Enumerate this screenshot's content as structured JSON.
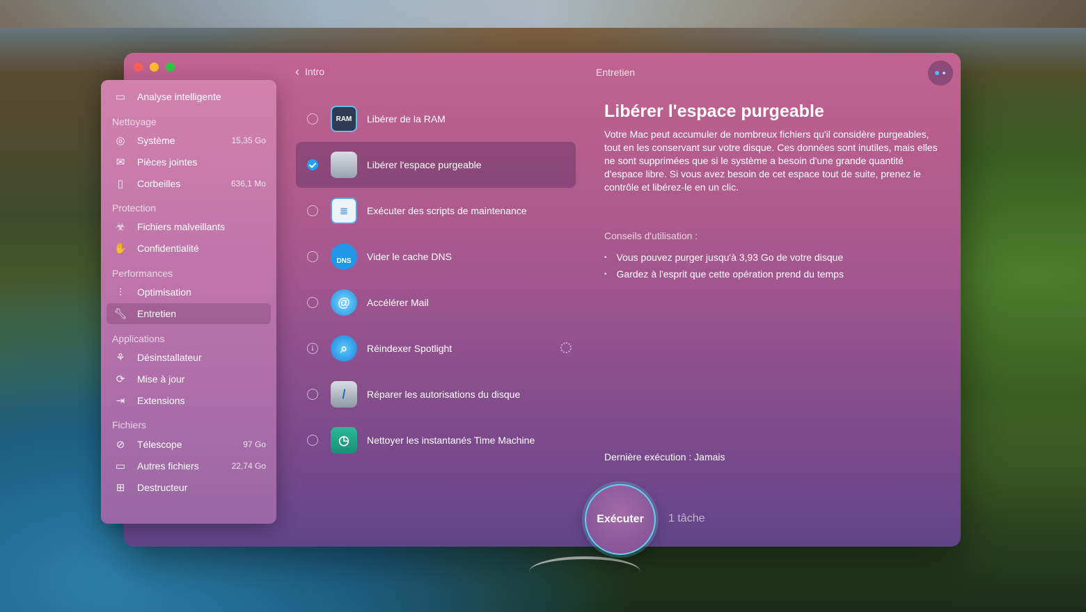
{
  "window": {
    "breadcrumb_back": "Intro",
    "title": "Entretien"
  },
  "sidebar": {
    "top_item": {
      "label": "Analyse intelligente",
      "icon": "monitor-icon"
    },
    "sections": [
      {
        "title": "Nettoyage",
        "items": [
          {
            "label": "Système",
            "size": "15,35 Go",
            "icon": "disk-icon"
          },
          {
            "label": "Pièces jointes",
            "size": "",
            "icon": "mail-icon"
          },
          {
            "label": "Corbeilles",
            "size": "636,1 Mo",
            "icon": "trash-icon"
          }
        ]
      },
      {
        "title": "Protection",
        "items": [
          {
            "label": "Fichiers malveillants",
            "size": "",
            "icon": "biohazard-icon"
          },
          {
            "label": "Confidentialité",
            "size": "",
            "icon": "hand-icon"
          }
        ]
      },
      {
        "title": "Performances",
        "items": [
          {
            "label": "Optimisation",
            "size": "",
            "icon": "sliders-icon"
          },
          {
            "label": "Entretien",
            "size": "",
            "icon": "wrench-icon",
            "active": true
          }
        ]
      },
      {
        "title": "Applications",
        "items": [
          {
            "label": "Désinstallateur",
            "size": "",
            "icon": "apps-icon"
          },
          {
            "label": "Mise à jour",
            "size": "",
            "icon": "update-icon"
          },
          {
            "label": "Extensions",
            "size": "",
            "icon": "extensions-icon"
          }
        ]
      },
      {
        "title": "Fichiers",
        "items": [
          {
            "label": "Télescope",
            "size": "97 Go",
            "icon": "telescope-icon"
          },
          {
            "label": "Autres fichiers",
            "size": "22,74 Go",
            "icon": "folder-icon"
          },
          {
            "label": "Destructeur",
            "size": "",
            "icon": "shredder-icon"
          }
        ]
      }
    ]
  },
  "tasks": [
    {
      "label": "Libérer de la RAM",
      "state": "unchecked",
      "icon": "ram-icon",
      "icon_text": "RAM"
    },
    {
      "label": "Libérer l'espace purgeable",
      "state": "checked",
      "icon": "drive-icon",
      "icon_text": ""
    },
    {
      "label": "Exécuter des scripts de maintenance",
      "state": "unchecked",
      "icon": "clipboard-icon",
      "icon_text": ""
    },
    {
      "label": "Vider le cache DNS",
      "state": "unchecked",
      "icon": "dns-icon",
      "icon_text": "DNS"
    },
    {
      "label": "Accélérer Mail",
      "state": "unchecked",
      "icon": "mail-speed-icon",
      "icon_text": ""
    },
    {
      "label": "Réindexer Spotlight",
      "state": "info",
      "icon": "spotlight-icon",
      "icon_text": ""
    },
    {
      "label": "Réparer les autorisations du disque",
      "state": "unchecked",
      "icon": "disk-repair-icon",
      "icon_text": ""
    },
    {
      "label": "Nettoyer les instantanés Time Machine",
      "state": "unchecked",
      "icon": "time-machine-icon",
      "icon_text": ""
    }
  ],
  "detail": {
    "title": "Libérer l'espace purgeable",
    "description": "Votre Mac peut accumuler de nombreux fichiers qu'il considère purgeables, tout en les conservant sur votre disque. Ces données sont inutiles, mais elles ne sont supprimées que si le système a besoin d'une grande quantité d'espace libre. Si vous avez besoin de cet espace tout de suite, prenez le contrôle et libérez-le en un clic.",
    "tips_title": "Conseils d'utilisation :",
    "tips": [
      "Vous pouvez purger jusqu'à 3,93 Go de votre disque",
      "Gardez à l'esprit que cette opération prend du temps"
    ],
    "last_run": "Dernière exécution : Jamais"
  },
  "footer": {
    "run_label": "Exécuter",
    "task_count": "1 tâche"
  },
  "colors": {
    "accent_blue": "#1ea1f7",
    "run_ring": "#62d2f0"
  }
}
